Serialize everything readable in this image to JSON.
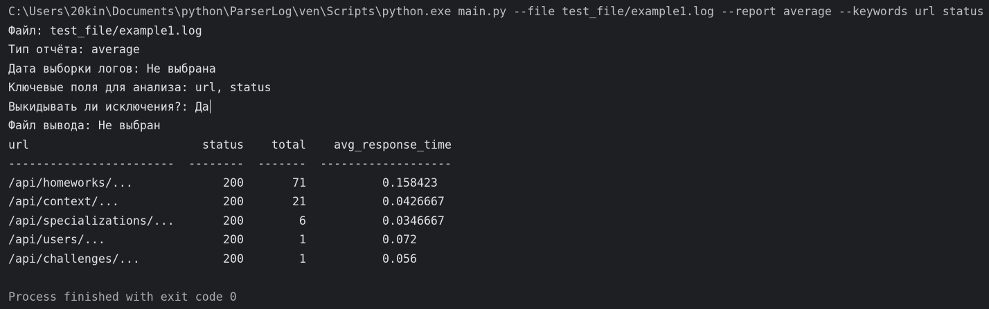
{
  "command": "C:\\Users\\20kin\\Documents\\python\\ParserLog\\ven\\Scripts\\python.exe main.py --file test_file/example1.log --report average --keywords url status",
  "info": [
    "Файл: test_file/example1.log",
    "Тип отчёта: average",
    "Дата выборки логов: Не выбрана",
    "Ключевые поля для анализа: url, status",
    "Выкидывать ли исключения?: Да",
    "Файл вывода: Не выбран"
  ],
  "table": {
    "headers": {
      "url": "url",
      "status": "status",
      "total": "total",
      "avg_response_time": "avg_response_time"
    },
    "separators": {
      "url": "------------------------",
      "status": "--------",
      "total": "-------",
      "avg_response_time": "-------------------"
    },
    "rows": [
      {
        "url": "/api/homeworks/...",
        "status": "200",
        "total": "71",
        "avg_response_time": "0.158423"
      },
      {
        "url": "/api/context/...",
        "status": "200",
        "total": "21",
        "avg_response_time": "0.0426667"
      },
      {
        "url": "/api/specializations/...",
        "status": "200",
        "total": "6",
        "avg_response_time": "0.0346667"
      },
      {
        "url": "/api/users/...",
        "status": "200",
        "total": "1",
        "avg_response_time": "0.072"
      },
      {
        "url": "/api/challenges/...",
        "status": "200",
        "total": "1",
        "avg_response_time": "0.056"
      }
    ]
  },
  "footer": "Process finished with exit code 0",
  "colors": {
    "background": "#1e1f22",
    "text": "#dfe1e5",
    "muted": "#a8adb4"
  }
}
